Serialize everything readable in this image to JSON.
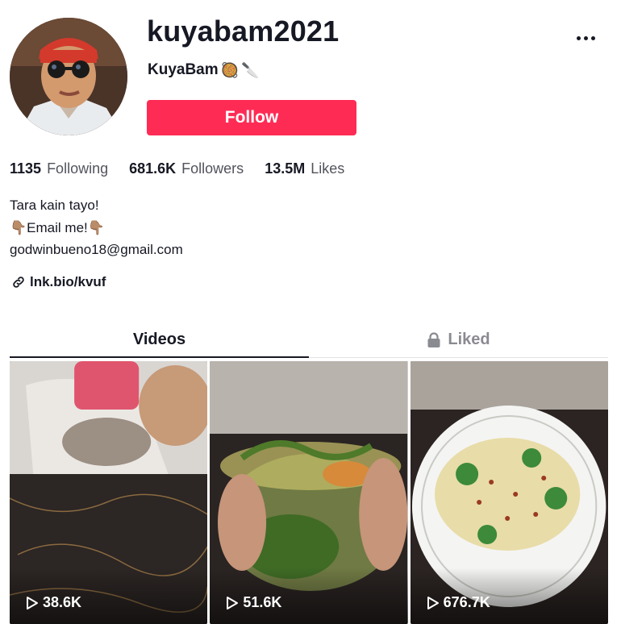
{
  "profile": {
    "username": "kuyabam2021",
    "nickname": "KuyaBam",
    "nickname_emojis": [
      "🥘",
      "🔪"
    ],
    "follow_label": "Follow",
    "more_icon": "more-dots-icon"
  },
  "stats": [
    {
      "value": "1135",
      "label": "Following"
    },
    {
      "value": "681.6K",
      "label": "Followers"
    },
    {
      "value": "13.5M",
      "label": "Likes"
    }
  ],
  "bio": {
    "line1": "Tara kain tayo!",
    "line2_prefix_emoji": "👇🏽",
    "line2_text": "Email me!",
    "line2_suffix_emoji": "👇🏽",
    "line3": "godwinbueno18@gmail.com"
  },
  "link": {
    "text": "lnk.bio/kvuf",
    "icon": "link-icon"
  },
  "tabs": [
    {
      "label": "Videos",
      "active": true
    },
    {
      "label": "Liked",
      "active": false,
      "icon": "lock-icon"
    }
  ],
  "videos": [
    {
      "views": "38.6K"
    },
    {
      "views": "51.6K"
    },
    {
      "views": "676.7K"
    }
  ],
  "colors": {
    "accent": "#fe2c55",
    "text": "#161823"
  }
}
